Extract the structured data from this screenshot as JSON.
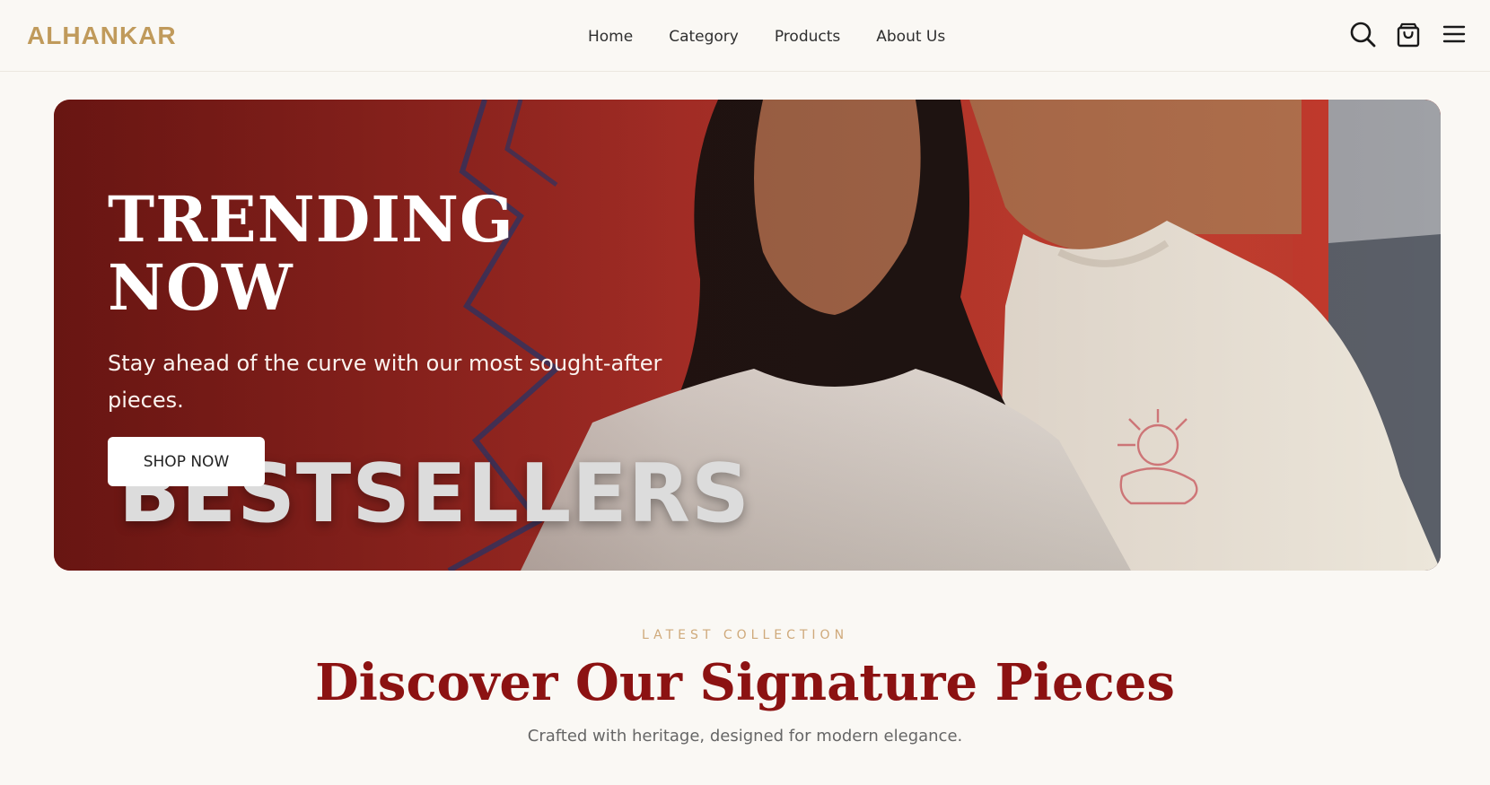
{
  "brand": {
    "name": "ALHANKAR",
    "color": "#c09a5b"
  },
  "nav": {
    "items": [
      {
        "label": "Home"
      },
      {
        "label": "Category"
      },
      {
        "label": "Products"
      },
      {
        "label": "About Us"
      }
    ]
  },
  "header_icons": [
    "search-icon",
    "shopping-bag-icon",
    "menu-icon"
  ],
  "hero": {
    "title_line1": "TRENDING",
    "title_line2": "NOW",
    "subtitle": "Stay ahead of the curve with our most sought-after pieces.",
    "cta_label": "SHOP NOW",
    "watermark": "BESTSELLERS",
    "colors": {
      "background_red": "#b8352c",
      "tshirt_cream": "#f1ece2"
    }
  },
  "collection": {
    "kicker": "LATEST COLLECTION",
    "title": "Discover Our Signature Pieces",
    "subtitle": "Crafted with heritage, designed for modern elegance.",
    "title_color": "#8c1212",
    "kicker_color": "#cfa97a"
  }
}
